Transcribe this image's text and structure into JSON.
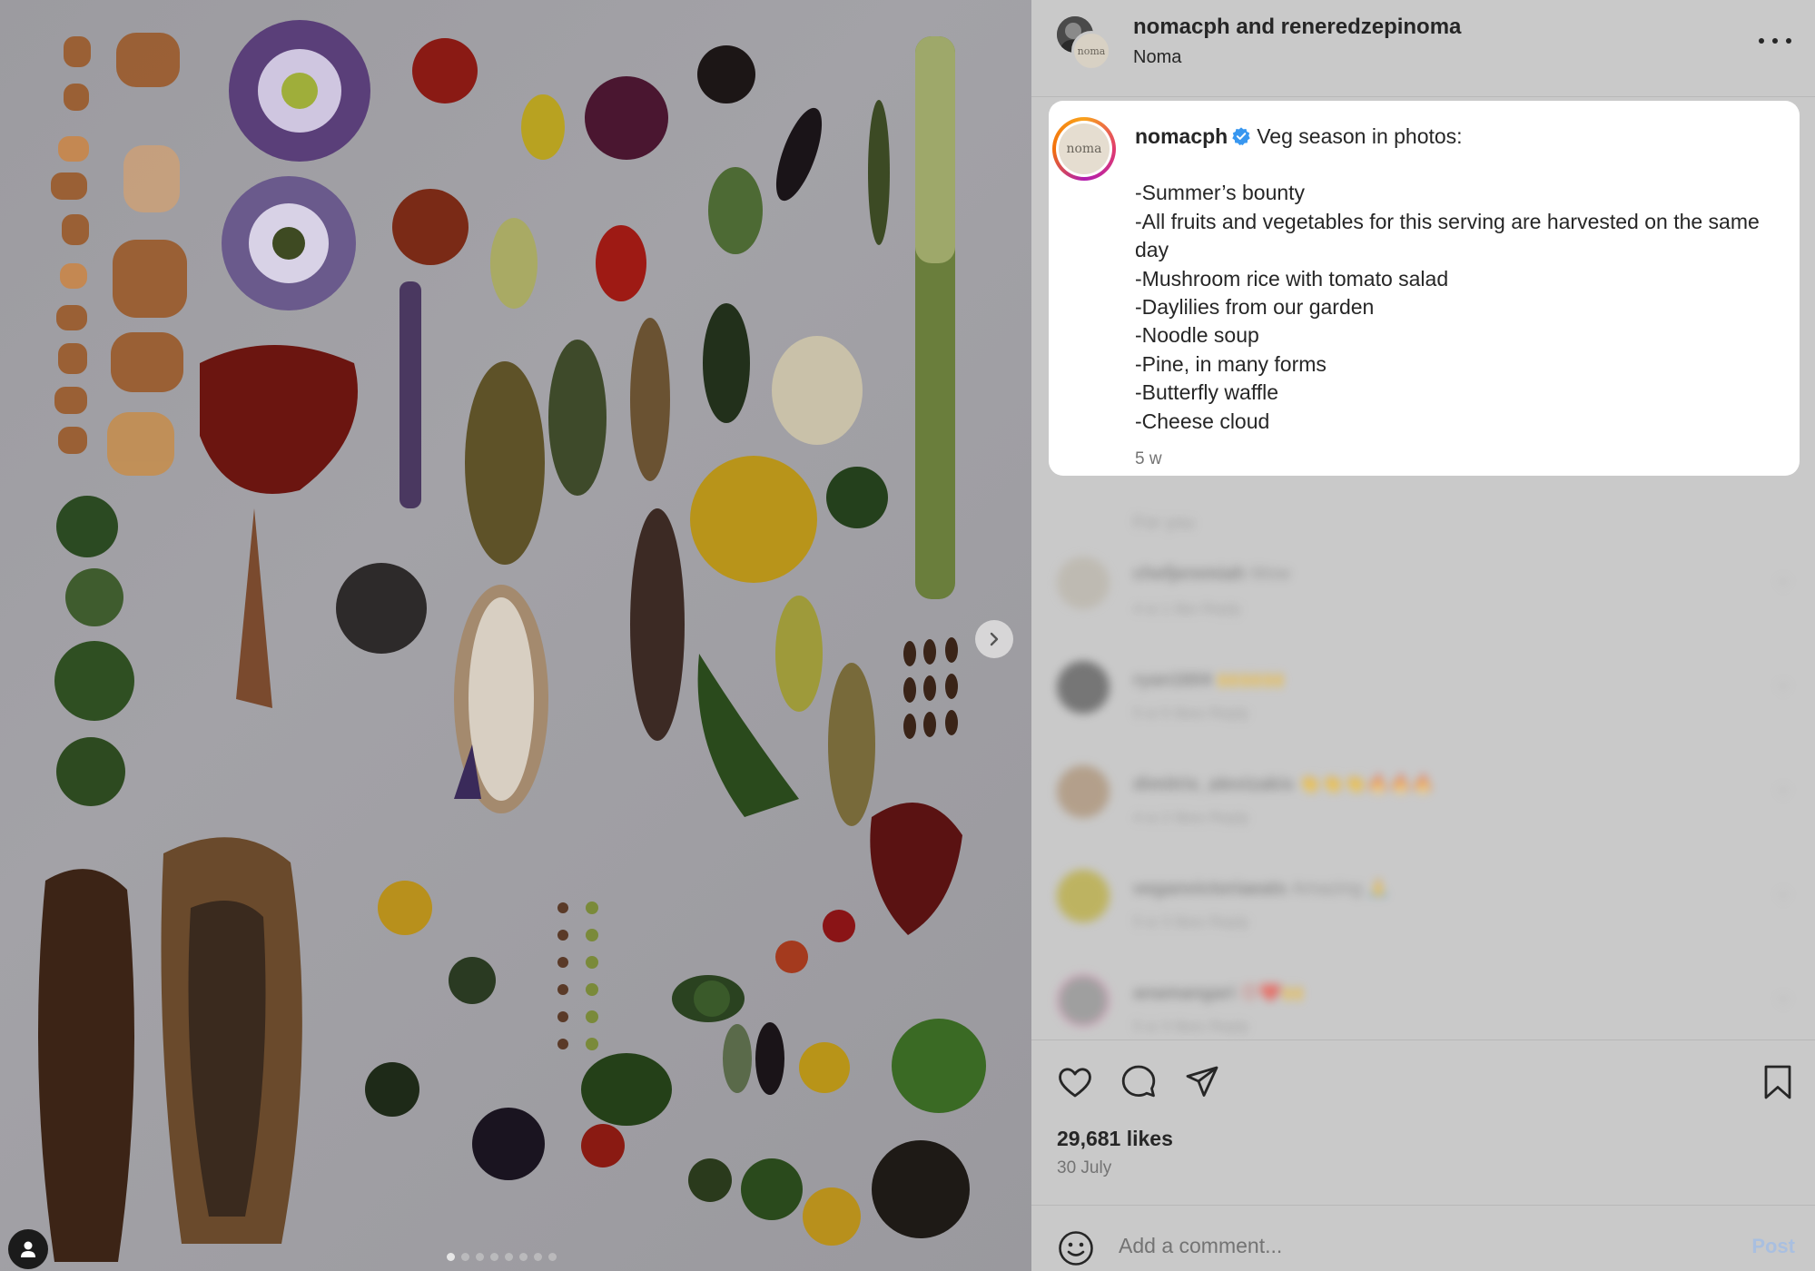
{
  "post": {
    "header_title": "nomacph and reneredzepinoma",
    "header_subtitle": "Noma",
    "avatar_text": "noma"
  },
  "caption": {
    "username": "nomacph",
    "headline": "Veg season in photos:",
    "lines": [
      "-Summer’s bounty",
      "-All fruits and vegetables for this serving are harvested on the same day",
      "-Mushroom rice with tomato salad",
      "-Daylilies from our garden",
      "-Noodle soup",
      "-Pine, in many forms",
      "-Butterfly waffle",
      "-Cheese cloud"
    ],
    "time": "5 w"
  },
  "comments_section": {
    "label": "For you",
    "items": [
      {
        "name": "chefjeremiah",
        "text": "Wow",
        "meta": "4 w   1 like   Reply"
      },
      {
        "name": "ryan1604",
        "text": "🙌🙌🙌",
        "meta": "5 w   5 likes   Reply"
      },
      {
        "name": "dimitris_alevizakis",
        "text": "👏👏👏🔥🔥🔥",
        "meta": "4 w   2 likes   Reply"
      },
      {
        "name": "veganvictoriaeats",
        "text": "Amazing 🙏",
        "meta": "5 w   3 likes   Reply"
      },
      {
        "name": "anamangari",
        "text": "😍❤️🙌",
        "meta": "5 w   3 likes   Reply"
      }
    ]
  },
  "engagement": {
    "likes": "29,681 likes",
    "date": "30 July"
  },
  "comment_box": {
    "placeholder": "Add a comment...",
    "post_label": "Post"
  },
  "carousel": {
    "slide_count": 8,
    "active_index": 0
  },
  "colors": {
    "verified": "#3897f0",
    "post_button": "#a9bfe0",
    "panel_background": "#c9c9c9"
  }
}
